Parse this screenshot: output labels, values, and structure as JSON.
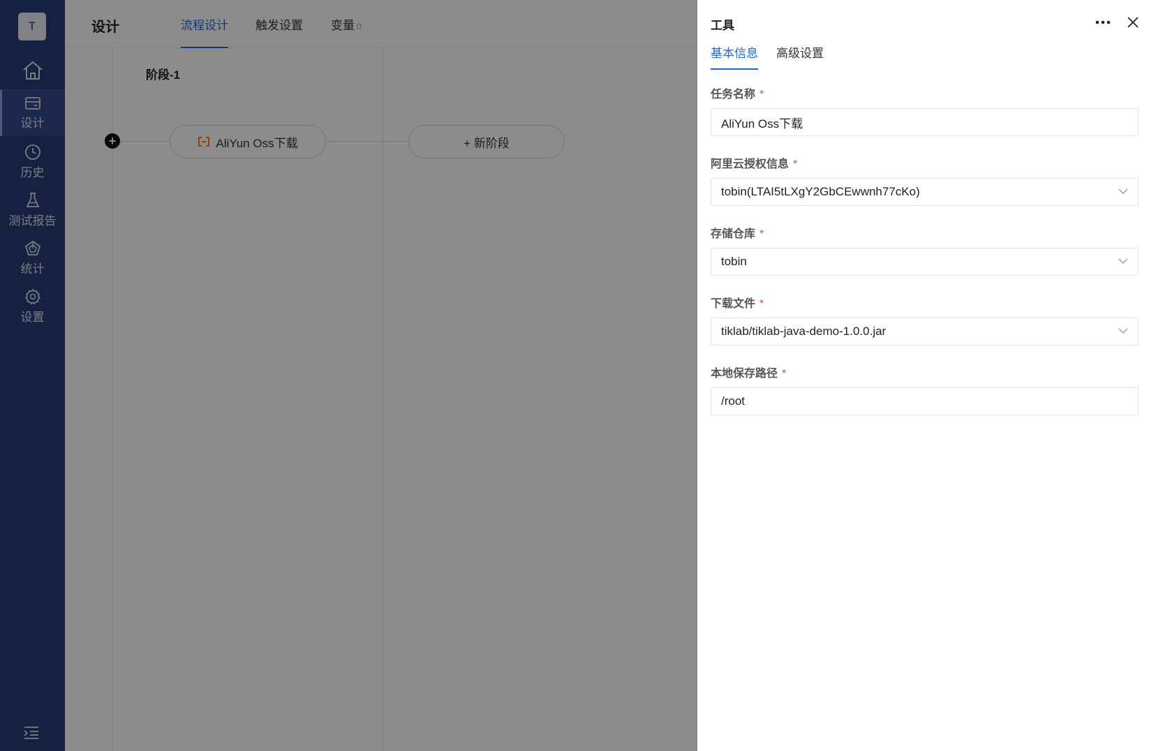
{
  "sidebar": {
    "avatar_letter": "T",
    "items": [
      {
        "label": "设计",
        "icon": "design-icon"
      },
      {
        "label": "历史",
        "icon": "clock-icon"
      },
      {
        "label": "测试报告",
        "icon": "flask-icon"
      },
      {
        "label": "统计",
        "icon": "stats-icon"
      },
      {
        "label": "设置",
        "icon": "gear-icon"
      }
    ]
  },
  "topbar": {
    "title": "设计",
    "tabs": [
      {
        "label": "流程设计",
        "active": true
      },
      {
        "label": "触发设置"
      },
      {
        "label": "变量",
        "count": "0"
      }
    ]
  },
  "canvas": {
    "stage_title": "阶段-1",
    "task_label": "AliYun Oss下载",
    "new_stage_label": "+ 新阶段"
  },
  "drawer": {
    "title": "工具",
    "tabs": [
      {
        "label": "基本信息",
        "active": true
      },
      {
        "label": "高级设置"
      }
    ],
    "fields": {
      "task_name": {
        "label": "任务名称",
        "value": "AliYun Oss下载"
      },
      "auth": {
        "label": "阿里云授权信息",
        "value": "tobin(LTAI5tLXgY2GbCEwwnh77cKo)"
      },
      "bucket": {
        "label": "存储仓库",
        "value": "tobin"
      },
      "file": {
        "label": "下载文件",
        "value": "tiklab/tiklab-java-demo-1.0.0.jar"
      },
      "local_path": {
        "label": "本地保存路径",
        "value": "/root"
      }
    },
    "required_mark": "*"
  },
  "colors": {
    "sidebar_bg": "#273c75",
    "accent": "#1f66d6",
    "required": "#e5484d"
  }
}
